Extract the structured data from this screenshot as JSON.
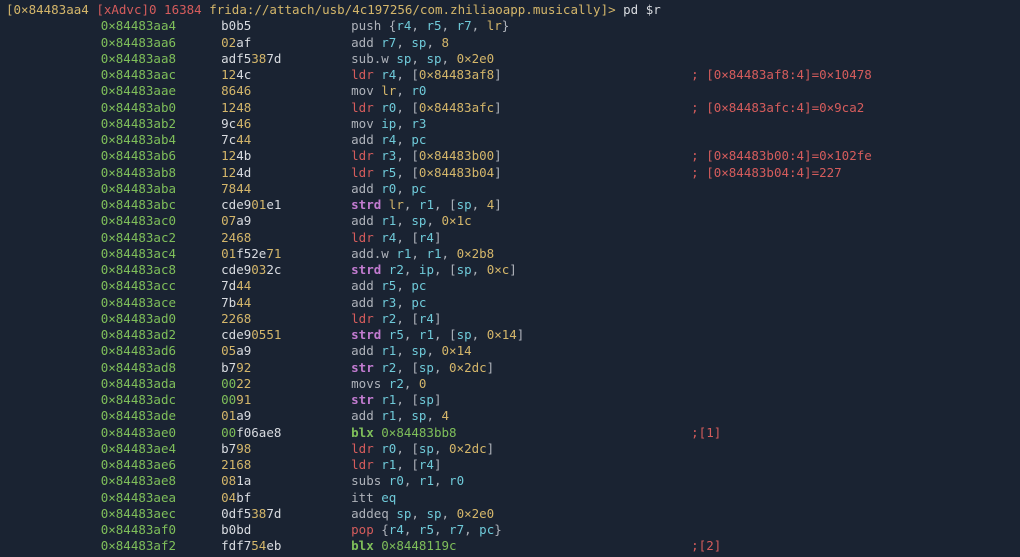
{
  "prompt": {
    "addr": "[0×84483aa4",
    "mid": " [xAdvc]0 16384 ",
    "uri": "frida://attach/usb/4c197256/com.zhiliaoapp.musically",
    "gt": "]> ",
    "cmd": "pd $r"
  },
  "rows": [
    {
      "a": "0×84483aa4",
      "h": "b0b5",
      "i": [
        [
          "mnem",
          "push"
        ],
        [
          "sp",
          " "
        ],
        [
          "br",
          "{"
        ],
        [
          "reg",
          "r4"
        ],
        [
          "t",
          ", "
        ],
        [
          "reg",
          "r5"
        ],
        [
          "t",
          ", "
        ],
        [
          "reg",
          "r7"
        ],
        [
          "t",
          ", "
        ],
        [
          "lr",
          "lr"
        ],
        [
          "br",
          "}"
        ]
      ],
      "c": ""
    },
    {
      "a": "0×84483aa6",
      "h": "02af",
      "i": [
        [
          "mnem",
          "add"
        ],
        [
          "sp",
          " "
        ],
        [
          "reg",
          "r7"
        ],
        [
          "t",
          ", "
        ],
        [
          "reg",
          "sp"
        ],
        [
          "t",
          ", "
        ],
        [
          "num",
          "8"
        ]
      ],
      "c": ""
    },
    {
      "a": "0×84483aa8",
      "h": "adf5387d",
      "i": [
        [
          "mnem",
          "sub.w"
        ],
        [
          "sp",
          " "
        ],
        [
          "reg",
          "sp"
        ],
        [
          "t",
          ", "
        ],
        [
          "reg",
          "sp"
        ],
        [
          "t",
          ", "
        ],
        [
          "num",
          "0×2e0"
        ]
      ],
      "c": ""
    },
    {
      "a": "0×84483aac",
      "h": "124c",
      "i": [
        [
          "red",
          "ldr"
        ],
        [
          "sp",
          " "
        ],
        [
          "reg",
          "r4"
        ],
        [
          "t",
          ", ["
        ],
        [
          "num",
          "0×84483af8"
        ],
        [
          "t",
          "]"
        ]
      ],
      "c": "; [0×84483af8:4]=0×10478"
    },
    {
      "a": "0×84483aae",
      "h": "8646",
      "i": [
        [
          "mnem",
          "mov"
        ],
        [
          "sp",
          " "
        ],
        [
          "lr",
          "lr"
        ],
        [
          "t",
          ", "
        ],
        [
          "reg",
          "r0"
        ]
      ],
      "c": ""
    },
    {
      "a": "0×84483ab0",
      "h": "1248",
      "i": [
        [
          "red",
          "ldr"
        ],
        [
          "sp",
          " "
        ],
        [
          "reg",
          "r0"
        ],
        [
          "t",
          ", ["
        ],
        [
          "num",
          "0×84483afc"
        ],
        [
          "t",
          "]"
        ]
      ],
      "c": "; [0×84483afc:4]=0×9ca2"
    },
    {
      "a": "0×84483ab2",
      "h": "9c46",
      "i": [
        [
          "mnem",
          "mov"
        ],
        [
          "sp",
          " "
        ],
        [
          "reg",
          "ip"
        ],
        [
          "t",
          ", "
        ],
        [
          "reg",
          "r3"
        ]
      ],
      "c": ""
    },
    {
      "a": "0×84483ab4",
      "h": "7c44",
      "i": [
        [
          "mnem",
          "add"
        ],
        [
          "sp",
          " "
        ],
        [
          "reg",
          "r4"
        ],
        [
          "t",
          ", "
        ],
        [
          "reg",
          "pc"
        ]
      ],
      "c": ""
    },
    {
      "a": "0×84483ab6",
      "h": "124b",
      "i": [
        [
          "red",
          "ldr"
        ],
        [
          "sp",
          " "
        ],
        [
          "reg",
          "r3"
        ],
        [
          "t",
          ", ["
        ],
        [
          "num",
          "0×84483b00"
        ],
        [
          "t",
          "]"
        ]
      ],
      "c": "; [0×84483b00:4]=0×102fe"
    },
    {
      "a": "0×84483ab8",
      "h": "124d",
      "i": [
        [
          "red",
          "ldr"
        ],
        [
          "sp",
          " "
        ],
        [
          "reg",
          "r5"
        ],
        [
          "t",
          ", ["
        ],
        [
          "num",
          "0×84483b04"
        ],
        [
          "t",
          "]"
        ]
      ],
      "c": "; [0×84483b04:4]=227"
    },
    {
      "a": "0×84483aba",
      "h": "7844",
      "i": [
        [
          "mnem",
          "add"
        ],
        [
          "sp",
          " "
        ],
        [
          "reg",
          "r0"
        ],
        [
          "t",
          ", "
        ],
        [
          "reg",
          "pc"
        ]
      ],
      "c": ""
    },
    {
      "a": "0×84483abc",
      "h": "cde901e1",
      "i": [
        [
          "strd",
          "strd"
        ],
        [
          "sp",
          " "
        ],
        [
          "lr",
          "lr"
        ],
        [
          "t",
          ", "
        ],
        [
          "reg",
          "r1"
        ],
        [
          "t",
          ", ["
        ],
        [
          "reg",
          "sp"
        ],
        [
          "t",
          ", "
        ],
        [
          "num",
          "4"
        ],
        [
          "t",
          "]"
        ]
      ],
      "c": ""
    },
    {
      "a": "0×84483ac0",
      "h": "07a9",
      "i": [
        [
          "mnem",
          "add"
        ],
        [
          "sp",
          " "
        ],
        [
          "reg",
          "r1"
        ],
        [
          "t",
          ", "
        ],
        [
          "reg",
          "sp"
        ],
        [
          "t",
          ", "
        ],
        [
          "num",
          "0×1c"
        ]
      ],
      "c": ""
    },
    {
      "a": "0×84483ac2",
      "h": "2468",
      "i": [
        [
          "red",
          "ldr"
        ],
        [
          "sp",
          " "
        ],
        [
          "reg",
          "r4"
        ],
        [
          "t",
          ", ["
        ],
        [
          "reg",
          "r4"
        ],
        [
          "t",
          "]"
        ]
      ],
      "c": ""
    },
    {
      "a": "0×84483ac4",
      "h": "01f52e71",
      "i": [
        [
          "mnem",
          "add.w"
        ],
        [
          "sp",
          " "
        ],
        [
          "reg",
          "r1"
        ],
        [
          "t",
          ", "
        ],
        [
          "reg",
          "r1"
        ],
        [
          "t",
          ", "
        ],
        [
          "num",
          "0×2b8"
        ]
      ],
      "c": ""
    },
    {
      "a": "0×84483ac8",
      "h": "cde9032c",
      "i": [
        [
          "strd",
          "strd"
        ],
        [
          "sp",
          " "
        ],
        [
          "reg",
          "r2"
        ],
        [
          "t",
          ", "
        ],
        [
          "reg",
          "ip"
        ],
        [
          "t",
          ", ["
        ],
        [
          "reg",
          "sp"
        ],
        [
          "t",
          ", "
        ],
        [
          "num",
          "0×c"
        ],
        [
          "t",
          "]"
        ]
      ],
      "c": ""
    },
    {
      "a": "0×84483acc",
      "h": "7d44",
      "i": [
        [
          "mnem",
          "add"
        ],
        [
          "sp",
          " "
        ],
        [
          "reg",
          "r5"
        ],
        [
          "t",
          ", "
        ],
        [
          "reg",
          "pc"
        ]
      ],
      "c": ""
    },
    {
      "a": "0×84483ace",
      "h": "7b44",
      "i": [
        [
          "mnem",
          "add"
        ],
        [
          "sp",
          " "
        ],
        [
          "reg",
          "r3"
        ],
        [
          "t",
          ", "
        ],
        [
          "reg",
          "pc"
        ]
      ],
      "c": ""
    },
    {
      "a": "0×84483ad0",
      "h": "2268",
      "i": [
        [
          "red",
          "ldr"
        ],
        [
          "sp",
          " "
        ],
        [
          "reg",
          "r2"
        ],
        [
          "t",
          ", ["
        ],
        [
          "reg",
          "r4"
        ],
        [
          "t",
          "]"
        ]
      ],
      "c": ""
    },
    {
      "a": "0×84483ad2",
      "h": "cde90551",
      "i": [
        [
          "strd",
          "strd"
        ],
        [
          "sp",
          " "
        ],
        [
          "reg",
          "r5"
        ],
        [
          "t",
          ", "
        ],
        [
          "reg",
          "r1"
        ],
        [
          "t",
          ", ["
        ],
        [
          "reg",
          "sp"
        ],
        [
          "t",
          ", "
        ],
        [
          "num",
          "0×14"
        ],
        [
          "t",
          "]"
        ]
      ],
      "c": ""
    },
    {
      "a": "0×84483ad6",
      "h": "05a9",
      "i": [
        [
          "mnem",
          "add"
        ],
        [
          "sp",
          " "
        ],
        [
          "reg",
          "r1"
        ],
        [
          "t",
          ", "
        ],
        [
          "reg",
          "sp"
        ],
        [
          "t",
          ", "
        ],
        [
          "num",
          "0×14"
        ]
      ],
      "c": ""
    },
    {
      "a": "0×84483ad8",
      "h": "b792",
      "i": [
        [
          "strd",
          "str"
        ],
        [
          "sp",
          " "
        ],
        [
          "reg",
          "r2"
        ],
        [
          "t",
          ", ["
        ],
        [
          "reg",
          "sp"
        ],
        [
          "t",
          ", "
        ],
        [
          "num",
          "0×2dc"
        ],
        [
          "t",
          "]"
        ]
      ],
      "c": ""
    },
    {
      "a": "0×84483ada",
      "h": "0022",
      "i": [
        [
          "mnem",
          "movs"
        ],
        [
          "sp",
          " "
        ],
        [
          "reg",
          "r2"
        ],
        [
          "t",
          ", "
        ],
        [
          "num",
          "0"
        ]
      ],
      "c": ""
    },
    {
      "a": "0×84483adc",
      "h": "0091",
      "i": [
        [
          "strd",
          "str"
        ],
        [
          "sp",
          " "
        ],
        [
          "reg",
          "r1"
        ],
        [
          "t",
          ", ["
        ],
        [
          "reg",
          "sp"
        ],
        [
          "t",
          "]"
        ]
      ],
      "c": ""
    },
    {
      "a": "0×84483ade",
      "h": "01a9",
      "i": [
        [
          "mnem",
          "add"
        ],
        [
          "sp",
          " "
        ],
        [
          "reg",
          "r1"
        ],
        [
          "t",
          ", "
        ],
        [
          "reg",
          "sp"
        ],
        [
          "t",
          ", "
        ],
        [
          "num",
          "4"
        ]
      ],
      "c": ""
    },
    {
      "a": "0×84483ae0",
      "h": "00f06ae8",
      "i": [
        [
          "blx",
          "blx"
        ],
        [
          "sp",
          " "
        ],
        [
          "numg",
          "0×84483bb8"
        ]
      ],
      "c": ";[1]"
    },
    {
      "a": "0×84483ae4",
      "h": "b798",
      "i": [
        [
          "red",
          "ldr"
        ],
        [
          "sp",
          " "
        ],
        [
          "reg",
          "r0"
        ],
        [
          "t",
          ", ["
        ],
        [
          "reg",
          "sp"
        ],
        [
          "t",
          ", "
        ],
        [
          "num",
          "0×2dc"
        ],
        [
          "t",
          "]"
        ]
      ],
      "c": ""
    },
    {
      "a": "0×84483ae6",
      "h": "2168",
      "i": [
        [
          "red",
          "ldr"
        ],
        [
          "sp",
          " "
        ],
        [
          "reg",
          "r1"
        ],
        [
          "t",
          ", ["
        ],
        [
          "reg",
          "r4"
        ],
        [
          "t",
          "]"
        ]
      ],
      "c": ""
    },
    {
      "a": "0×84483ae8",
      "h": "081a",
      "i": [
        [
          "mnem",
          "subs"
        ],
        [
          "sp",
          " "
        ],
        [
          "reg",
          "r0"
        ],
        [
          "t",
          ", "
        ],
        [
          "reg",
          "r1"
        ],
        [
          "t",
          ", "
        ],
        [
          "reg",
          "r0"
        ]
      ],
      "c": ""
    },
    {
      "a": "0×84483aea",
      "h": "04bf",
      "i": [
        [
          "mnem",
          "itt"
        ],
        [
          "sp",
          " "
        ],
        [
          "reg",
          "eq"
        ]
      ],
      "c": ""
    },
    {
      "a": "0×84483aec",
      "h": "0df5387d",
      "i": [
        [
          "mnem",
          "addeq"
        ],
        [
          "sp",
          " "
        ],
        [
          "reg",
          "sp"
        ],
        [
          "t",
          ", "
        ],
        [
          "reg",
          "sp"
        ],
        [
          "t",
          ", "
        ],
        [
          "num",
          "0×2e0"
        ]
      ],
      "c": ""
    },
    {
      "a": "0×84483af0",
      "h": "b0bd",
      "i": [
        [
          "red",
          "pop"
        ],
        [
          "sp",
          " "
        ],
        [
          "br",
          "{"
        ],
        [
          "reg",
          "r4"
        ],
        [
          "t",
          ", "
        ],
        [
          "reg",
          "r5"
        ],
        [
          "t",
          ", "
        ],
        [
          "reg",
          "r7"
        ],
        [
          "t",
          ", "
        ],
        [
          "reg",
          "pc"
        ],
        [
          "br",
          "}"
        ]
      ],
      "c": ""
    },
    {
      "a": "0×84483af2",
      "h": "fdf754eb",
      "i": [
        [
          "blx",
          "blx"
        ],
        [
          "sp",
          " "
        ],
        [
          "numg",
          "0×8448119c"
        ]
      ],
      "c": ";[2]"
    }
  ]
}
